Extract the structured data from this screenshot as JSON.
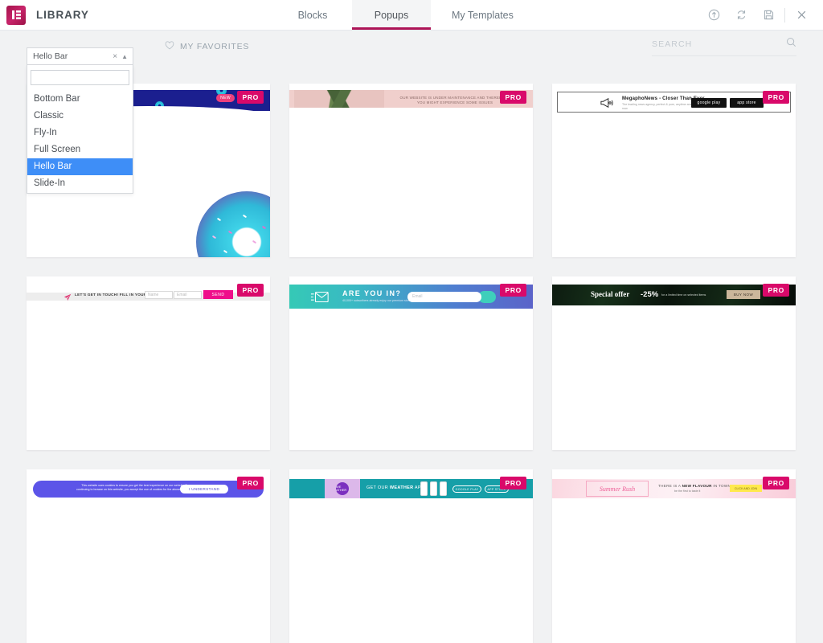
{
  "header": {
    "brand_title": "LIBRARY",
    "logo_icon": "elementor-logo-icon",
    "tabs": [
      {
        "label": "Blocks",
        "active": false
      },
      {
        "label": "Popups",
        "active": true
      },
      {
        "label": "My Templates",
        "active": false
      }
    ],
    "actions": [
      {
        "name": "import-icon",
        "glyph": "import"
      },
      {
        "name": "sync-icon",
        "glyph": "sync"
      },
      {
        "name": "save-icon",
        "glyph": "save"
      },
      {
        "name": "close-icon",
        "glyph": "close"
      }
    ]
  },
  "toolbar": {
    "favorites_label": "MY FAVORITES",
    "favorites_icon": "heart-icon",
    "search_placeholder": "SEARCH",
    "search_value": "",
    "search_icon": "search-icon"
  },
  "filter_dropdown": {
    "selected": "Hello Bar",
    "open": true,
    "clear_label": "×",
    "caret": "▲",
    "search_value": "",
    "options": [
      "Bottom Bar",
      "Classic",
      "Fly-In",
      "Full Screen",
      "Hello Bar",
      "Slide-In"
    ]
  },
  "badges": {
    "pro_label": "PRO"
  },
  "colors": {
    "accent": "#ad1457",
    "pro_badge": "#d9096a",
    "dropdown_selected": "#3e8ef7",
    "page_background": "#f1f2f3",
    "card_background": "#ffffff"
  },
  "templates": [
    {
      "id": "donut-hello-bar",
      "kind": "donut",
      "badge": "NEW",
      "pro": "PRO"
    },
    {
      "id": "maintenance-hello-bar",
      "kind": "maintenance",
      "headline": "OUR WEBSITE IS UNDER MAINTENANCE AND THEREFORE YOU MIGHT EXPERIENCE SOME ISSUES",
      "pro": "PRO"
    },
    {
      "id": "megaphonews-hello-bar",
      "kind": "megaphone",
      "icon": "megaphone-icon",
      "headline": "MegaphoNews - Closer Than Ever",
      "subline": "The leading news agency, perfect & pure, anytime anew. Download now.",
      "buttons": [
        "google play",
        "app store"
      ],
      "pro": "PRO"
    },
    {
      "id": "get-in-touch-hello-bar",
      "kind": "contact",
      "icon": "paper-plane-icon",
      "headline": "LET'S GET IN TOUCH! FILL IN YOUR DETAILS",
      "fields": [
        "Name",
        "Email"
      ],
      "button": "SEND",
      "pro": "PRO"
    },
    {
      "id": "are-you-in-hello-bar",
      "kind": "newsletter",
      "icon": "envelope-icon",
      "headline": "ARE YOU IN?",
      "subline": "40,000+ subscribers already enjoy our premium stuff",
      "field": "Email",
      "pro": "PRO"
    },
    {
      "id": "special-offer-hello-bar",
      "kind": "offer",
      "headline": "Special offer",
      "discount": "-25%",
      "subline": "for a limited time on selected items",
      "button": "BUY NOW",
      "pro": "PRO"
    },
    {
      "id": "cookies-hello-bar",
      "kind": "cookies",
      "text": "This website uses cookies to ensure you get the best experience on our website. By continuing to browse on this website, you accept the use of cookies for the above purposes.",
      "button": "I UNDERSTAND",
      "pro": "PRO"
    },
    {
      "id": "weather-app-hello-bar",
      "kind": "weather",
      "logo": "WE ATHER",
      "headline_plain": "GET OUR ",
      "headline_bold": "WEATHER",
      "headline_tail": " APP",
      "buttons": [
        "GOOGLE PLAY",
        "APP STORE"
      ],
      "pro": "PRO"
    },
    {
      "id": "summer-rush-hello-bar",
      "kind": "summer",
      "tag": "Summer Rush",
      "headline_pre": "THERE IS A ",
      "headline_bold": "NEW FLAVOUR",
      "headline_post": " IN TOWN",
      "subline": "be the first to taste it",
      "button": "CLICK AND JOIN",
      "pro": "PRO"
    }
  ]
}
